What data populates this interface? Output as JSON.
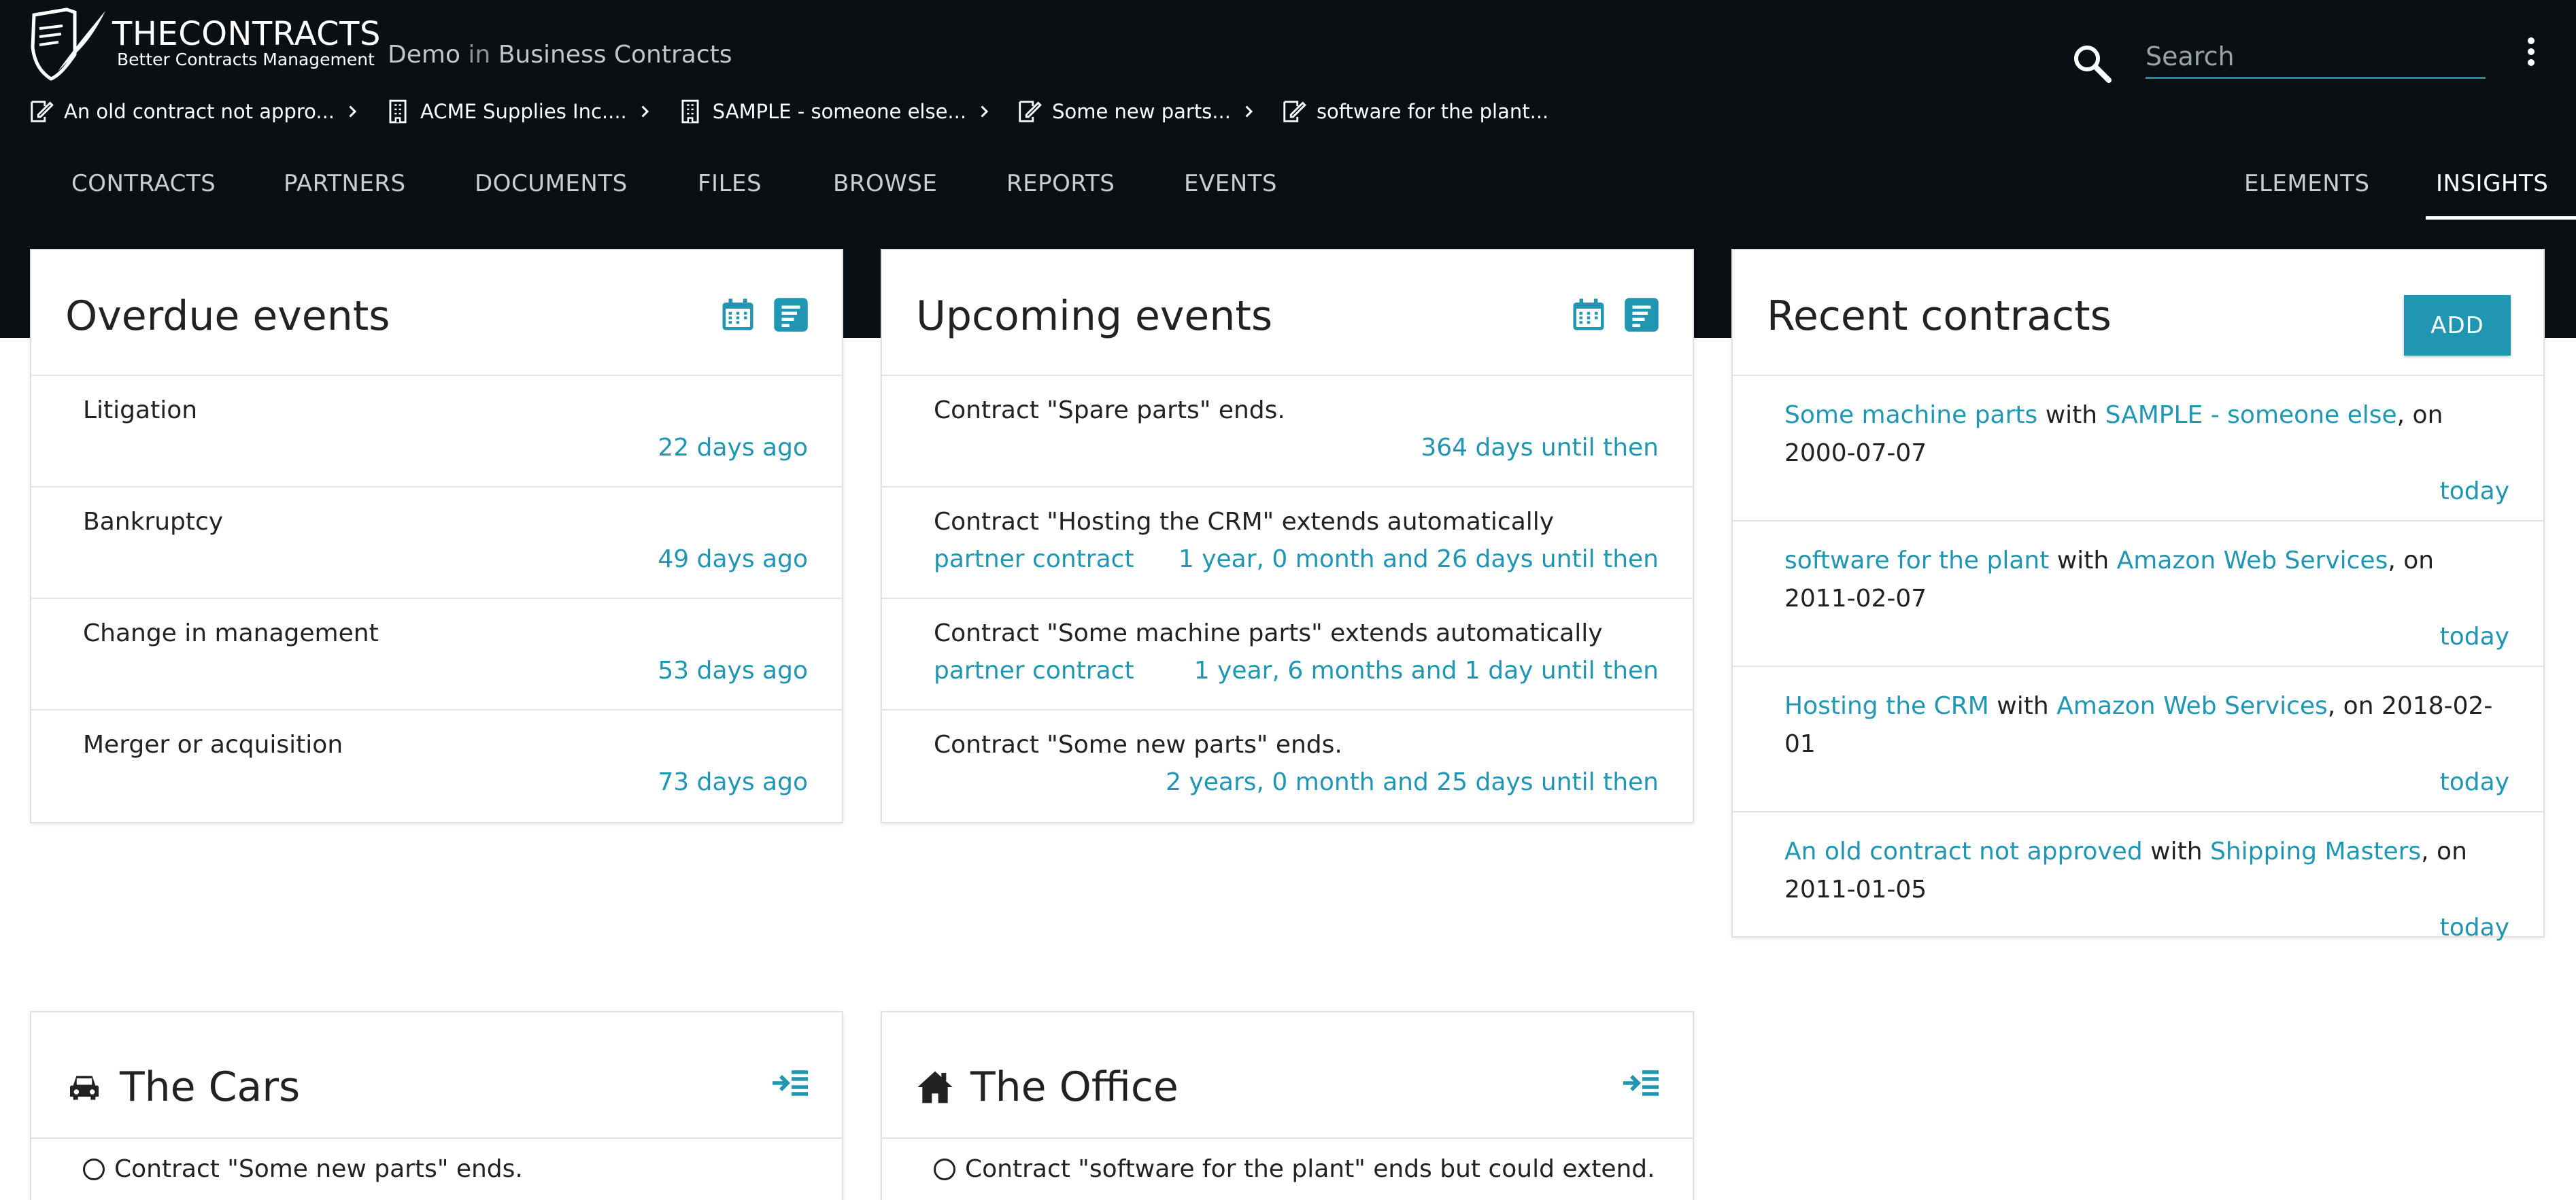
{
  "brand": {
    "name": "THECONTRACTS",
    "tagline": "Better Contracts Management",
    "context_org": "Demo",
    "context_in": "in",
    "context_area": "Business Contracts"
  },
  "search": {
    "placeholder": "Search"
  },
  "breadcrumbs": [
    {
      "label": "An old contract not appro...",
      "icon": "contract-icon"
    },
    {
      "label": "ACME Supplies Inc....",
      "icon": "building-icon"
    },
    {
      "label": "SAMPLE - someone else...",
      "icon": "building-icon"
    },
    {
      "label": "Some new parts...",
      "icon": "contract-icon"
    },
    {
      "label": "software for the plant...",
      "icon": "contract-icon"
    }
  ],
  "nav": {
    "contracts": "CONTRACTS",
    "partners": "PARTNERS",
    "documents": "DOCUMENTS",
    "files": "FILES",
    "browse": "BROWSE",
    "reports": "REPORTS",
    "events": "EVENTS",
    "elements": "ELEMENTS",
    "insights": "INSIGHTS"
  },
  "overdue": {
    "title": "Overdue events",
    "items": [
      {
        "label": "Litigation",
        "when": "22 days ago"
      },
      {
        "label": "Bankruptcy",
        "when": "49 days ago"
      },
      {
        "label": "Change in management",
        "when": "53 days ago"
      },
      {
        "label": "Merger or acquisition",
        "when": "73 days ago"
      }
    ]
  },
  "upcoming": {
    "title": "Upcoming events",
    "items": [
      {
        "label": "Contract \"Spare parts\" ends.",
        "sub": "",
        "when": "364 days until then"
      },
      {
        "label": "Contract \"Hosting the CRM\" extends automatically",
        "sub": "partner contract",
        "when": "1 year, 0 month and 26 days until then"
      },
      {
        "label": "Contract \"Some machine parts\" extends automatically",
        "sub": "partner contract",
        "when": "1 year, 6 months and 1 day until then"
      },
      {
        "label": "Contract \"Some new parts\" ends.",
        "sub": "",
        "when": "2 years, 0 month and 25 days until then"
      }
    ]
  },
  "recent": {
    "title": "Recent contracts",
    "add_label": "ADD",
    "with_word": "with",
    "on_word": ", on",
    "items": [
      {
        "contract": "Some machine parts",
        "partner": "SAMPLE - someone else",
        "date": "2000-07-07",
        "when": "today"
      },
      {
        "contract": "software for the plant",
        "partner": "Amazon Web Services",
        "date": "2011-02-07",
        "when": "today"
      },
      {
        "contract": "Hosting the CRM",
        "partner": "Amazon Web Services",
        "date": "2018-02-01",
        "when": "today"
      },
      {
        "contract": "An old contract not approved",
        "partner": "Shipping Masters",
        "date": "2011-01-05",
        "when": "today"
      }
    ]
  },
  "groups": [
    {
      "title": "The Cars",
      "icon": "car-icon",
      "item": "Contract \"Some new parts\" ends."
    },
    {
      "title": "The Office",
      "icon": "home-icon",
      "item": "Contract \"software for the plant\" ends but could extend."
    }
  ],
  "colors": {
    "accent": "#2196b3",
    "header": "#0a0f13"
  }
}
